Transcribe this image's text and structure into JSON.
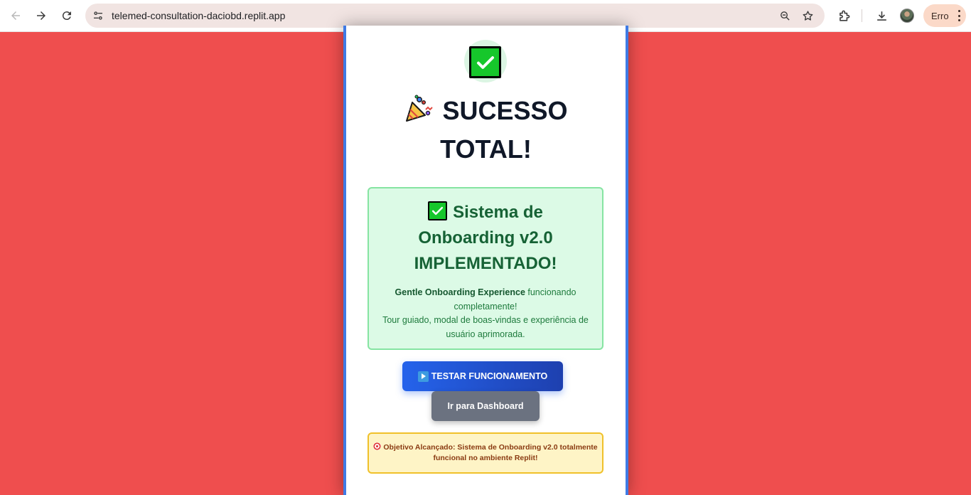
{
  "browser": {
    "url": "telemed-consultation-daciobd.replit.app",
    "profile_label": "Erro",
    "icons": [
      "back-icon",
      "forward-icon",
      "reload-icon",
      "site-settings-icon",
      "zoom-icon",
      "bookmark-star-icon",
      "extensions-icon",
      "downloads-icon",
      "avatar",
      "menu-kebab-icon"
    ]
  },
  "page": {
    "headline": "SUCESSO TOTAL!",
    "headline_icon": "party-popper-icon",
    "top_icon": "check-mark-icon",
    "success_box": {
      "title": "Sistema de Onboarding v2.0 IMPLEMENTADO!",
      "highlight": "Gentle Onboarding Experience",
      "text_line1_rest": " funcionando completamente!",
      "text_line2": "Tour guiado, modal de boas-vindas e experiência de usuário aprimorada."
    },
    "primary_button": "TESTAR FUNCIONAMENTO",
    "secondary_button": "Ir para Dashboard",
    "goal_text": "Objetivo Alcançado: Sistema de Onboarding v2.0 totalmente funcional no ambiente Replit!"
  },
  "colors": {
    "page_background": "#ef4e4e",
    "card_border": "#3f7be5",
    "success_green": "#166235",
    "primary_button": "#2563eb",
    "secondary_button": "#6b7280",
    "goal_background": "#fef4c6"
  }
}
